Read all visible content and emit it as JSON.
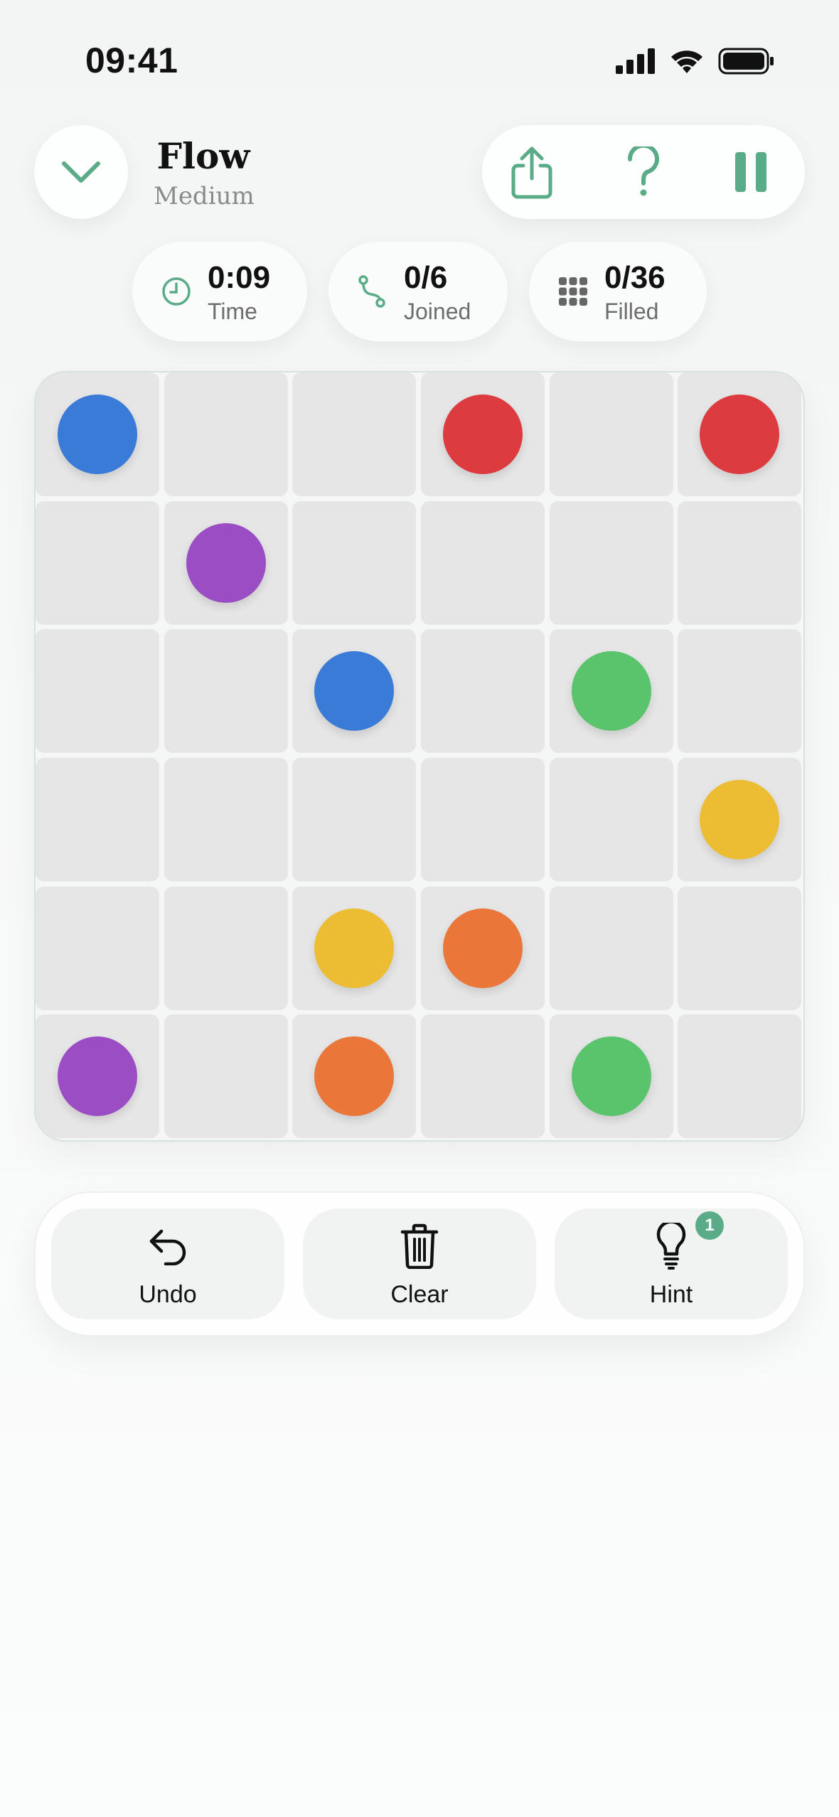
{
  "status_bar": {
    "time": "09:41"
  },
  "header": {
    "title": "Flow",
    "difficulty": "Medium"
  },
  "stats": [
    {
      "value": "0:09",
      "label": "Time",
      "icon": "clock-icon"
    },
    {
      "value": "0/6",
      "label": "Joined",
      "icon": "path-icon"
    },
    {
      "value": "0/36",
      "label": "Filled",
      "icon": "grid-icon"
    }
  ],
  "board": {
    "rows": 6,
    "cols": 6,
    "dots": [
      {
        "row": 0,
        "col": 0,
        "color": "#3b7bd8"
      },
      {
        "row": 0,
        "col": 3,
        "color": "#dc3b40"
      },
      {
        "row": 0,
        "col": 5,
        "color": "#dc3b40"
      },
      {
        "row": 1,
        "col": 1,
        "color": "#9b4dc4"
      },
      {
        "row": 2,
        "col": 2,
        "color": "#3b7bd8"
      },
      {
        "row": 2,
        "col": 4,
        "color": "#59c46c"
      },
      {
        "row": 3,
        "col": 5,
        "color": "#ecbd33"
      },
      {
        "row": 4,
        "col": 2,
        "color": "#ecbd33"
      },
      {
        "row": 4,
        "col": 3,
        "color": "#ea763a"
      },
      {
        "row": 5,
        "col": 0,
        "color": "#9b4dc4"
      },
      {
        "row": 5,
        "col": 2,
        "color": "#ea763a"
      },
      {
        "row": 5,
        "col": 4,
        "color": "#59c46c"
      }
    ]
  },
  "toolbar": {
    "undo_label": "Undo",
    "clear_label": "Clear",
    "hint_label": "Hint",
    "hint_count": "1"
  },
  "colors": {
    "accent": "#5aab88"
  }
}
